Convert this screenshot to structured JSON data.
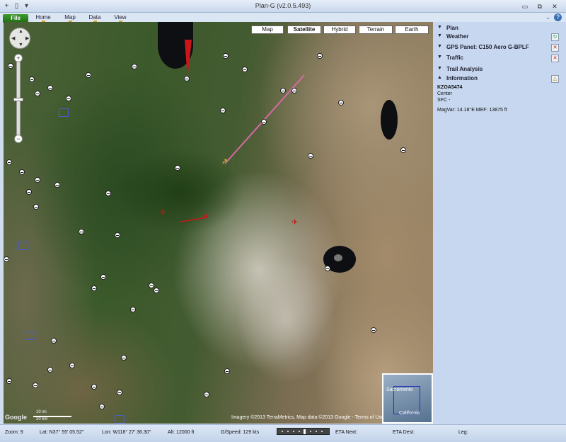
{
  "window": {
    "title": "Plan-G (v2.0.5.493)",
    "minimize_glyph": "▭",
    "restore_glyph": "⧉",
    "close_glyph": "✕",
    "collapse_glyph": "⌄",
    "help_glyph": "?"
  },
  "ribbon": {
    "file_label": "File",
    "tabs": [
      "Home",
      "Map",
      "Data",
      "View"
    ]
  },
  "map": {
    "types": [
      "Map",
      "Satellite",
      "Hybrid",
      "Terrain",
      "Earth"
    ],
    "selected_type": "Satellite",
    "zoom_in": "+",
    "zoom_out": "−",
    "scale_top": "10 mi",
    "scale_bottom": "20 km",
    "attribution": "Imagery ©2013 TerraMetrics, Map data ©2013 Google - Terms of Use",
    "google_logo": "Google",
    "overview_labels": [
      "Sacramento",
      "California"
    ]
  },
  "panel": {
    "sections": [
      {
        "label": "Plan",
        "button": ""
      },
      {
        "label": "Weather",
        "button": "↻"
      },
      {
        "label": "GPS Panel: C150 Aero G-BPLF",
        "button": "✕"
      },
      {
        "label": "Traffic",
        "button": "✕"
      },
      {
        "label": "Trail Analysis",
        "button": ""
      },
      {
        "label": "Information",
        "button": "△"
      }
    ],
    "info": {
      "ident": "KZOA5474",
      "type": "Center",
      "alt": "SFC -",
      "magvar": "MagVar: 14.18°E MEF: 13875 ft"
    }
  },
  "status": {
    "zoom": "Zoom: 9",
    "lat": "Lat: N37° 55' 05.52\"",
    "lon": "Lon: W118° 27' 36.30\"",
    "alt": "Alt: 12000 ft",
    "gspeed": "G/Speed: 129 kts",
    "eta_next": "ETA Next:",
    "eta_dest": "ETA Dest:",
    "leg": "Leg:"
  },
  "colors": {
    "accent": "#1f6d15",
    "route": "#d66aa6",
    "aircraft": "#e6cc1a",
    "traffic": "#c8161a"
  }
}
